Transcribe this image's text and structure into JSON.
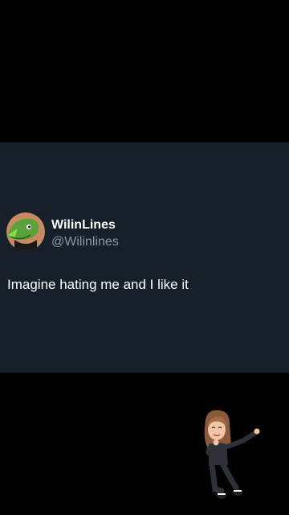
{
  "tweet": {
    "display_name": "WilinLines",
    "handle": "@Wilinlines",
    "text": "Imagine hating me and I like it",
    "avatar_icon": "green-character-avatar-icon",
    "colors": {
      "card_background": "#15202b",
      "page_background": "#000000",
      "name_color": "#ffffff",
      "handle_color": "#8b98a5",
      "avatar_background": "#c98a5f"
    }
  },
  "overlay": {
    "sticker_icon": "dancing-avatar-sticker-icon"
  }
}
